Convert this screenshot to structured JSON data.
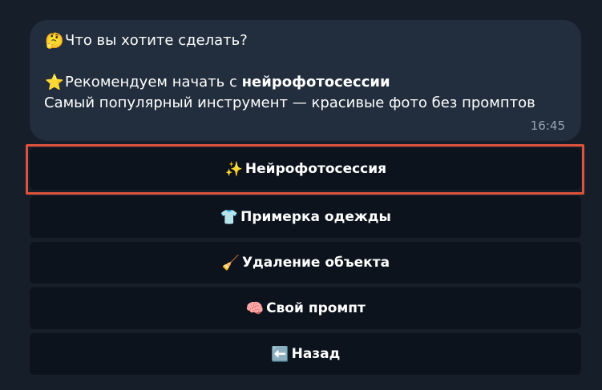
{
  "message": {
    "question_emoji": "🤔",
    "question": "Что вы хотите сделать?",
    "recommend_emoji": "⭐",
    "recommend_prefix": "Рекомендуем начать с ",
    "recommend_bold": "нейрофотосессии",
    "description": "Самый популярный инструмент — красивые фото без промптов",
    "time": "16:45"
  },
  "keyboard": [
    {
      "emoji": "✨",
      "label": "Нейрофотосессия"
    },
    {
      "emoji": "👕",
      "label": "Примерка одежды"
    },
    {
      "emoji": "🧹",
      "label": "Удаление объекта"
    },
    {
      "emoji": "🧠",
      "label": "Свой промпт"
    },
    {
      "emoji": "⬅️",
      "label": "Назад"
    }
  ],
  "colors": {
    "background": "#151e29",
    "bubble": "#222e3d",
    "button": "#0c131c",
    "highlight": "#e0533b"
  }
}
